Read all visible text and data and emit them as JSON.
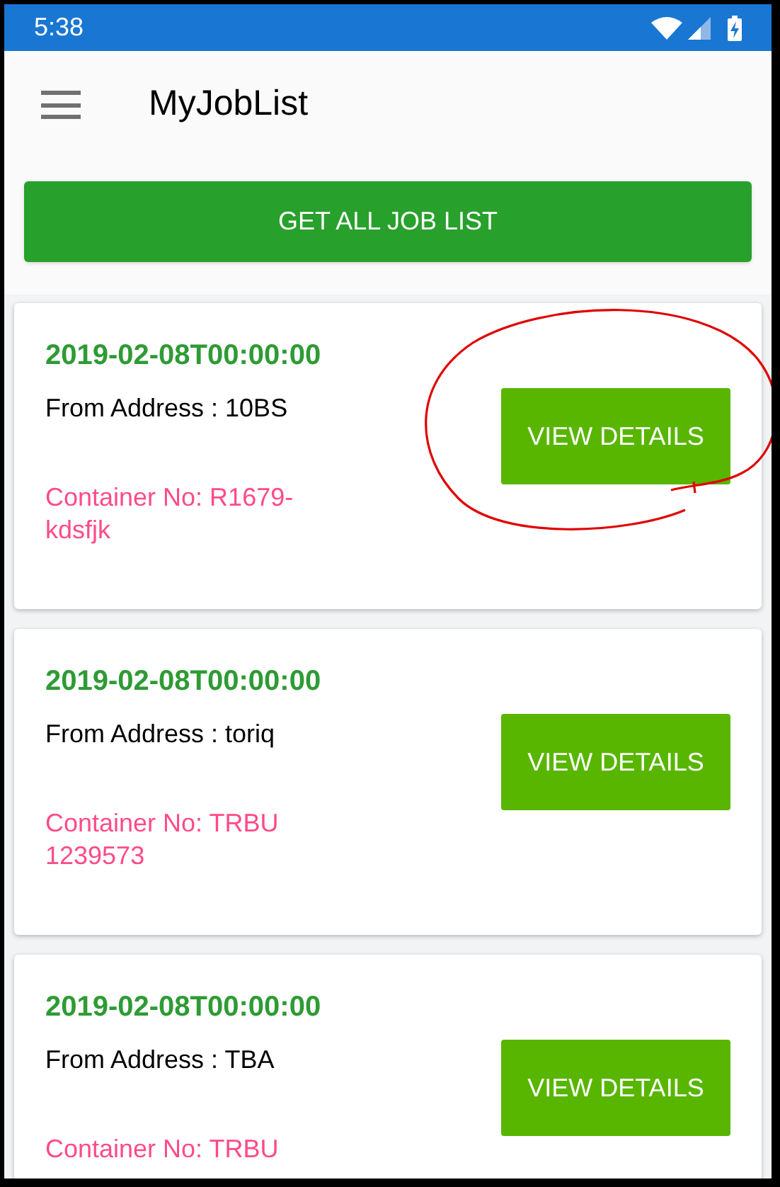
{
  "status_bar": {
    "time": "5:38"
  },
  "app_bar": {
    "title": "MyJobList"
  },
  "primary_button": {
    "label": "GET ALL JOB LIST"
  },
  "jobs": [
    {
      "date": "2019-02-08T00:00:00",
      "address": "From Address : 10BS",
      "container": "Container No: R1679-kdsfjk",
      "button": "VIEW DETAILS",
      "circled": true
    },
    {
      "date": "2019-02-08T00:00:00",
      "address": "From Address : toriq",
      "container": "Container No: TRBU 1239573",
      "button": "VIEW DETAILS",
      "circled": false
    },
    {
      "date": "2019-02-08T00:00:00",
      "address": "From Address : TBA",
      "container": "Container No: TRBU",
      "button": "VIEW DETAILS",
      "circled": false
    }
  ]
}
